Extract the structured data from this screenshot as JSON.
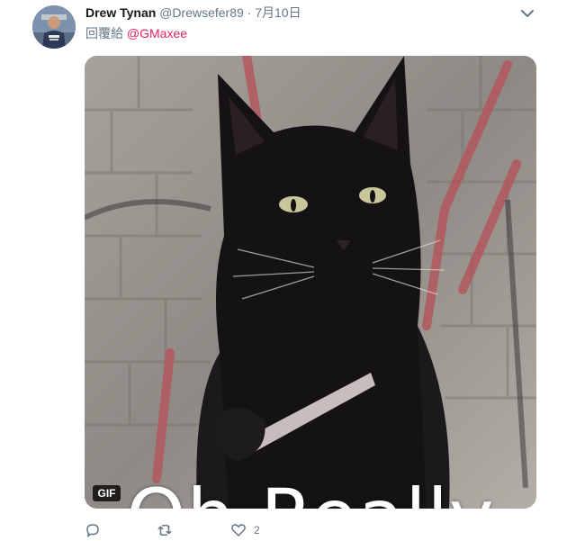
{
  "tweet": {
    "author": {
      "name": "Drew Tynan",
      "handle": "@Drewsefer89"
    },
    "separator": "·",
    "date": "7月10日",
    "reply_prefix": "回覆給",
    "reply_to": "@GMaxee",
    "media": {
      "caption": "Oh Really",
      "badge": "GIF"
    },
    "actions": {
      "reply_icon": "reply-icon",
      "retweet_icon": "retweet-icon",
      "like_icon": "heart-icon",
      "like_count": "2"
    }
  },
  "colors": {
    "name": "#14171a",
    "secondary": "#657786",
    "mention": "#e0245e",
    "badge_bg": "#000000"
  }
}
